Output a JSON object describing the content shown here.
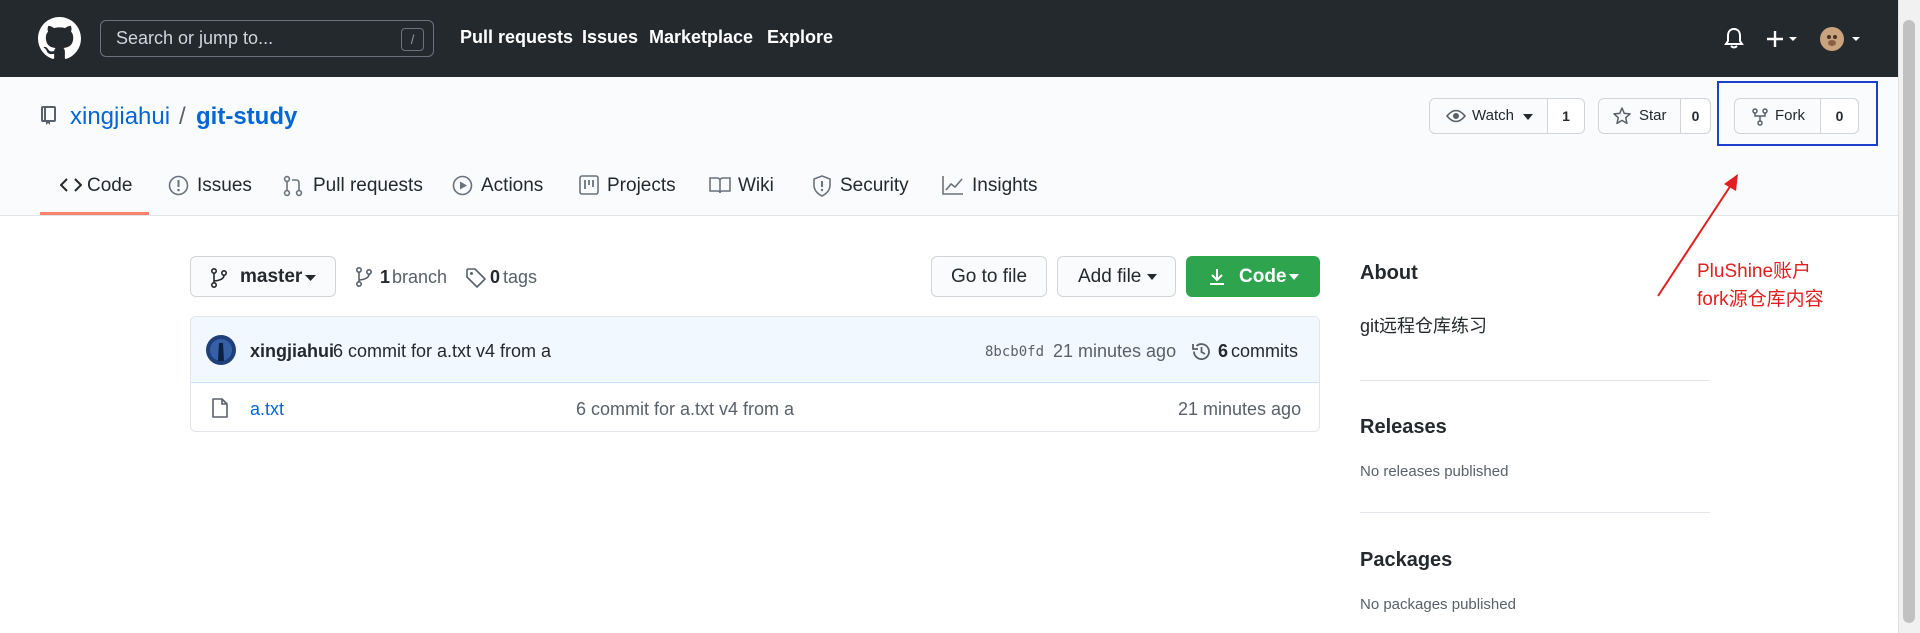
{
  "topnav": {
    "search_placeholder": "Search or jump to...",
    "search_shortcut": "/",
    "links": [
      "Pull requests",
      "Issues",
      "Marketplace",
      "Explore"
    ]
  },
  "repo": {
    "owner": "xingjiahui",
    "separator": "/",
    "name": "git-study",
    "watch_label": "Watch",
    "watch_count": "1",
    "star_label": "Star",
    "star_count": "0",
    "fork_label": "Fork",
    "fork_count": "0"
  },
  "tabs": [
    {
      "label": "Code",
      "icon": "code-icon",
      "selected": true
    },
    {
      "label": "Issues",
      "icon": "issue-icon"
    },
    {
      "label": "Pull requests",
      "icon": "pull-request-icon"
    },
    {
      "label": "Actions",
      "icon": "play-icon"
    },
    {
      "label": "Projects",
      "icon": "project-icon"
    },
    {
      "label": "Wiki",
      "icon": "book-icon"
    },
    {
      "label": "Security",
      "icon": "shield-icon"
    },
    {
      "label": "Insights",
      "icon": "graph-icon"
    }
  ],
  "toolbar": {
    "branch": "master",
    "branch_count": "1",
    "branch_label": "branch",
    "tag_count": "0",
    "tag_label": "tags",
    "go_to_file": "Go to file",
    "add_file": "Add file",
    "code": "Code"
  },
  "commit": {
    "author": "xingjiahui",
    "message": "6 commit for a.txt v4 from a",
    "sha": "8bcb0fd",
    "time": "21 minutes ago",
    "commit_count": "6",
    "commit_label": "commits"
  },
  "files": [
    {
      "name": "a.txt",
      "message": "6 commit for a.txt v4 from a",
      "time": "21 minutes ago"
    }
  ],
  "sidebar": {
    "about_title": "About",
    "description": "git远程仓库练习",
    "releases_title": "Releases",
    "releases_empty": "No releases published",
    "packages_title": "Packages",
    "packages_empty": "No packages published"
  },
  "annotation": {
    "line1": "PluShine账户",
    "line2": "fork源仓库内容"
  },
  "colors": {
    "header_bg": "#24292e",
    "link": "#0366d6",
    "green_button": "#2ea44f",
    "tab_underline": "#f9826c",
    "annotation_red": "#e02020",
    "annotation_box": "#1c3fcf"
  }
}
